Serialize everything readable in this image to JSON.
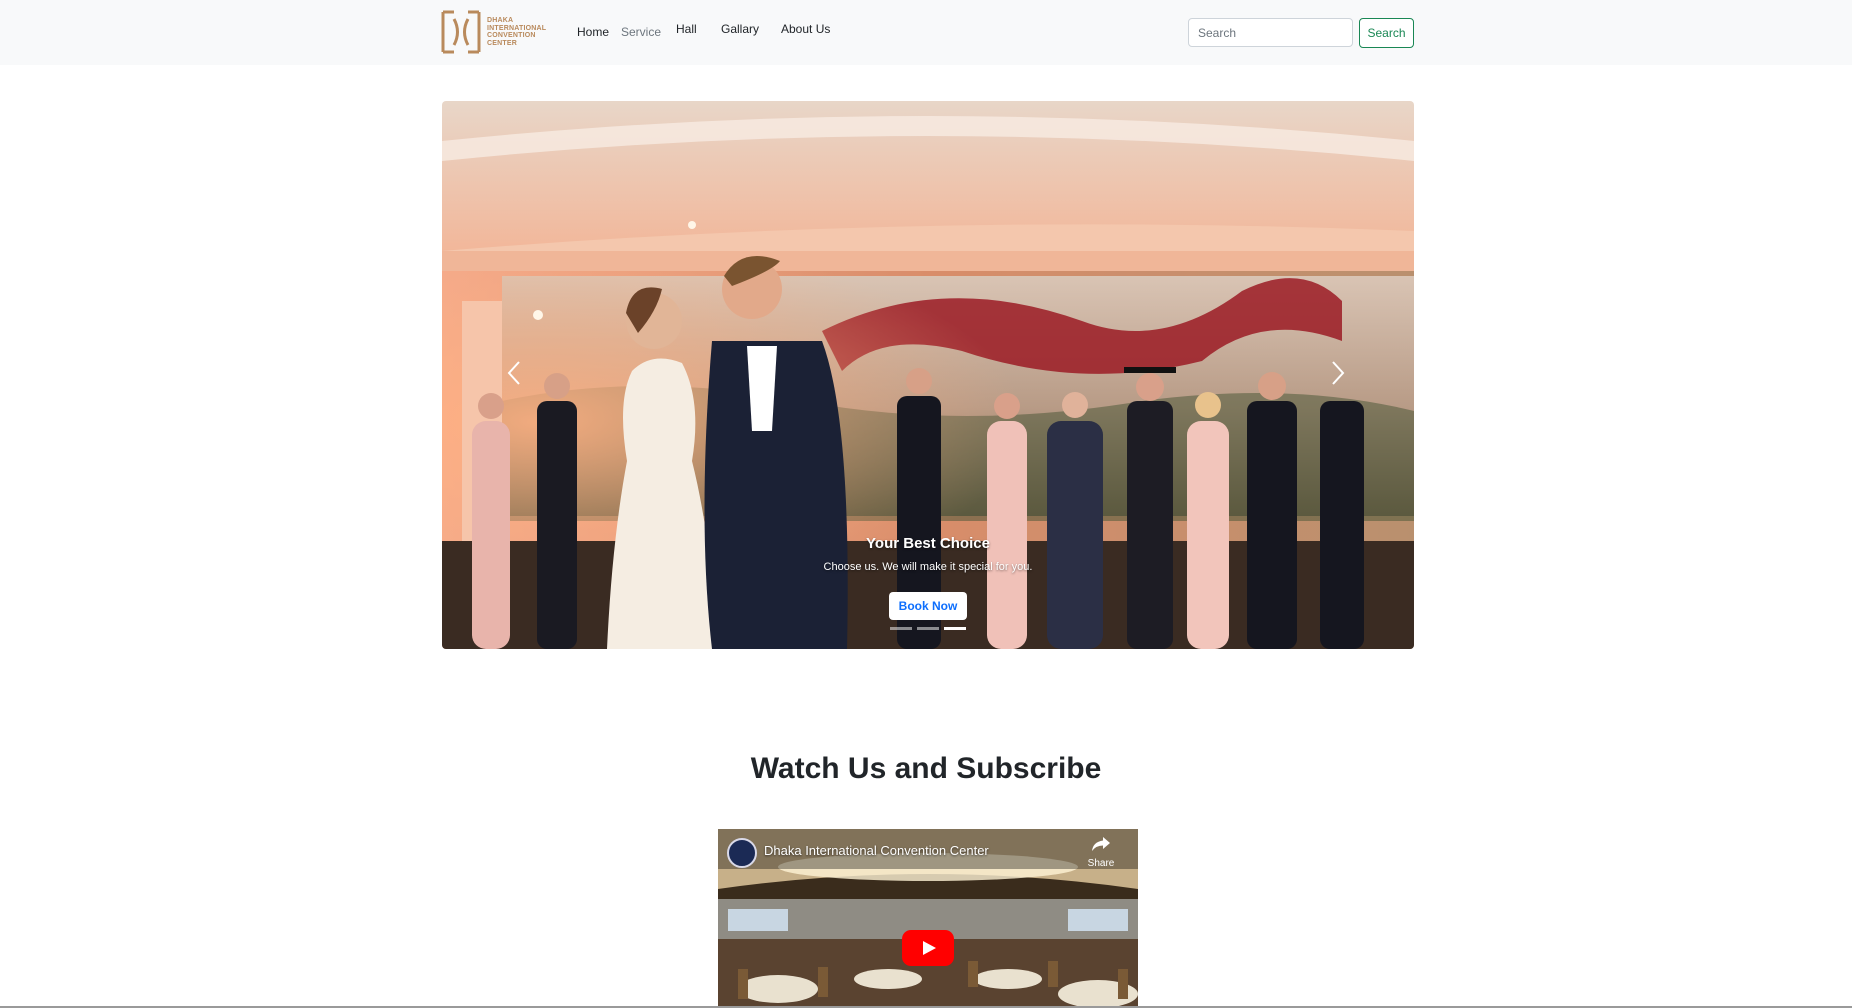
{
  "brand": {
    "logo_name": "dicc-logo",
    "text_lines": [
      "DHAKA",
      "INTERNATIONAL",
      "CONVENTION",
      "CENTER"
    ],
    "color": "#b98a5c"
  },
  "nav": {
    "items": [
      {
        "label": "Home"
      },
      {
        "label": "Service"
      },
      {
        "label": "Hall"
      },
      {
        "label": "Gallary"
      },
      {
        "label": "About Us"
      }
    ]
  },
  "search": {
    "placeholder": "Search",
    "value": "",
    "button_label": "Search",
    "button_color": "#198754"
  },
  "carousel": {
    "caption_title": "Your Best Choice",
    "caption_text": "Choose us. We will make it special for you.",
    "book_button": "Book Now",
    "book_button_color": "#0d6efd",
    "prev_icon": "chevron-left-icon",
    "next_icon": "chevron-right-icon",
    "slides_count": 3,
    "active_slide": 3
  },
  "video_section": {
    "heading": "Watch Us and Subscribe",
    "video_title": "Dhaka International Convention Center",
    "share_label": "Share",
    "play_icon": "youtube-play-icon",
    "play_color": "#ff0000"
  }
}
